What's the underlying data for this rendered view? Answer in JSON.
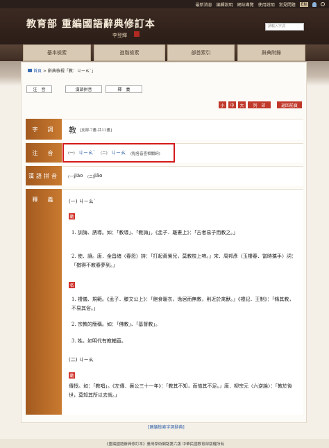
{
  "topbar": {
    "links": [
      "最新消息",
      "編輯說明",
      "網站導覽",
      "使用說明",
      "常見問題"
    ],
    "lang": "EN"
  },
  "banner": {
    "title": "教育部 重編國語辭典修訂本",
    "signature": "李登輝",
    "search_placeholder": "請輸入字詞"
  },
  "nav": [
    "基本檢索",
    "進階檢索",
    "部首索引",
    "辭典附錄"
  ],
  "breadcrumb": {
    "home": "首頁",
    "rest": "> 辭典檢視「教：ㄐㄧㄠˋ」"
  },
  "tabs": [
    "注　音",
    "漢語拼音",
    "釋　義"
  ],
  "tools": {
    "small": "小",
    "medium": "中",
    "large": "大",
    "print": "列　印",
    "back": "返回前頁"
  },
  "entry": {
    "labels": {
      "word": "字　詞",
      "zhuyin": "注　音",
      "pinyin": "漢語拼音",
      "definition": "釋　義"
    },
    "word": "教",
    "word_meta": "[支部-7畫-共11畫]",
    "zhuyin": {
      "n1": "(一)",
      "z1": "ㄐㄧㄠˋ",
      "n2": "(二)",
      "z2": "ㄐㄧㄠ",
      "note": "(點各音查相關詞)"
    },
    "pinyin": {
      "n1": "(一)",
      "p1": "jiào",
      "n2": "(二)",
      "p2": "jiāo"
    },
    "def_head1": "(一) ㄐㄧㄠˋ",
    "pos_verb": "動",
    "pos_noun": "名",
    "d1": "1. 訓誨、誘導。如：「教導」、「教誨」。《孟子．離婁上》：「古者易子而教之。」",
    "d2": "2. 使、讓。唐．金昌緒〈春怨〉詩：「打起黃鶯兒，莫教枝上啼。」宋．周邦彥〈玉樓春．當時攜手〉詞：「猶得不教春夢到。」",
    "n1": "1. 禮儀、規範。《孟子．滕文公上》：「飽食暖衣，逸居而無教，則近於禽獸。」《禮記．王制》：「脩其教，不易其俗。」",
    "n2": "2. 宗教的簡稱。如：「佛教」、「基督教」。",
    "n3": "3. 姓。如明代有教輔直。",
    "def_head2": "(二) ㄐㄧㄠ",
    "d3": "傳授。如：「教唱」。《左傳．襄公三十一年》：「教其不知，而恤其不足。」唐．柳宗元〈六逆論〉：「教於後世，莫知其所以去就。」"
  },
  "feedback": "[建議檢索字詞辭典]",
  "footer": "《重編國語辭典修訂本》臺灣學術網路第六版 中華民國教育部版權所有"
}
